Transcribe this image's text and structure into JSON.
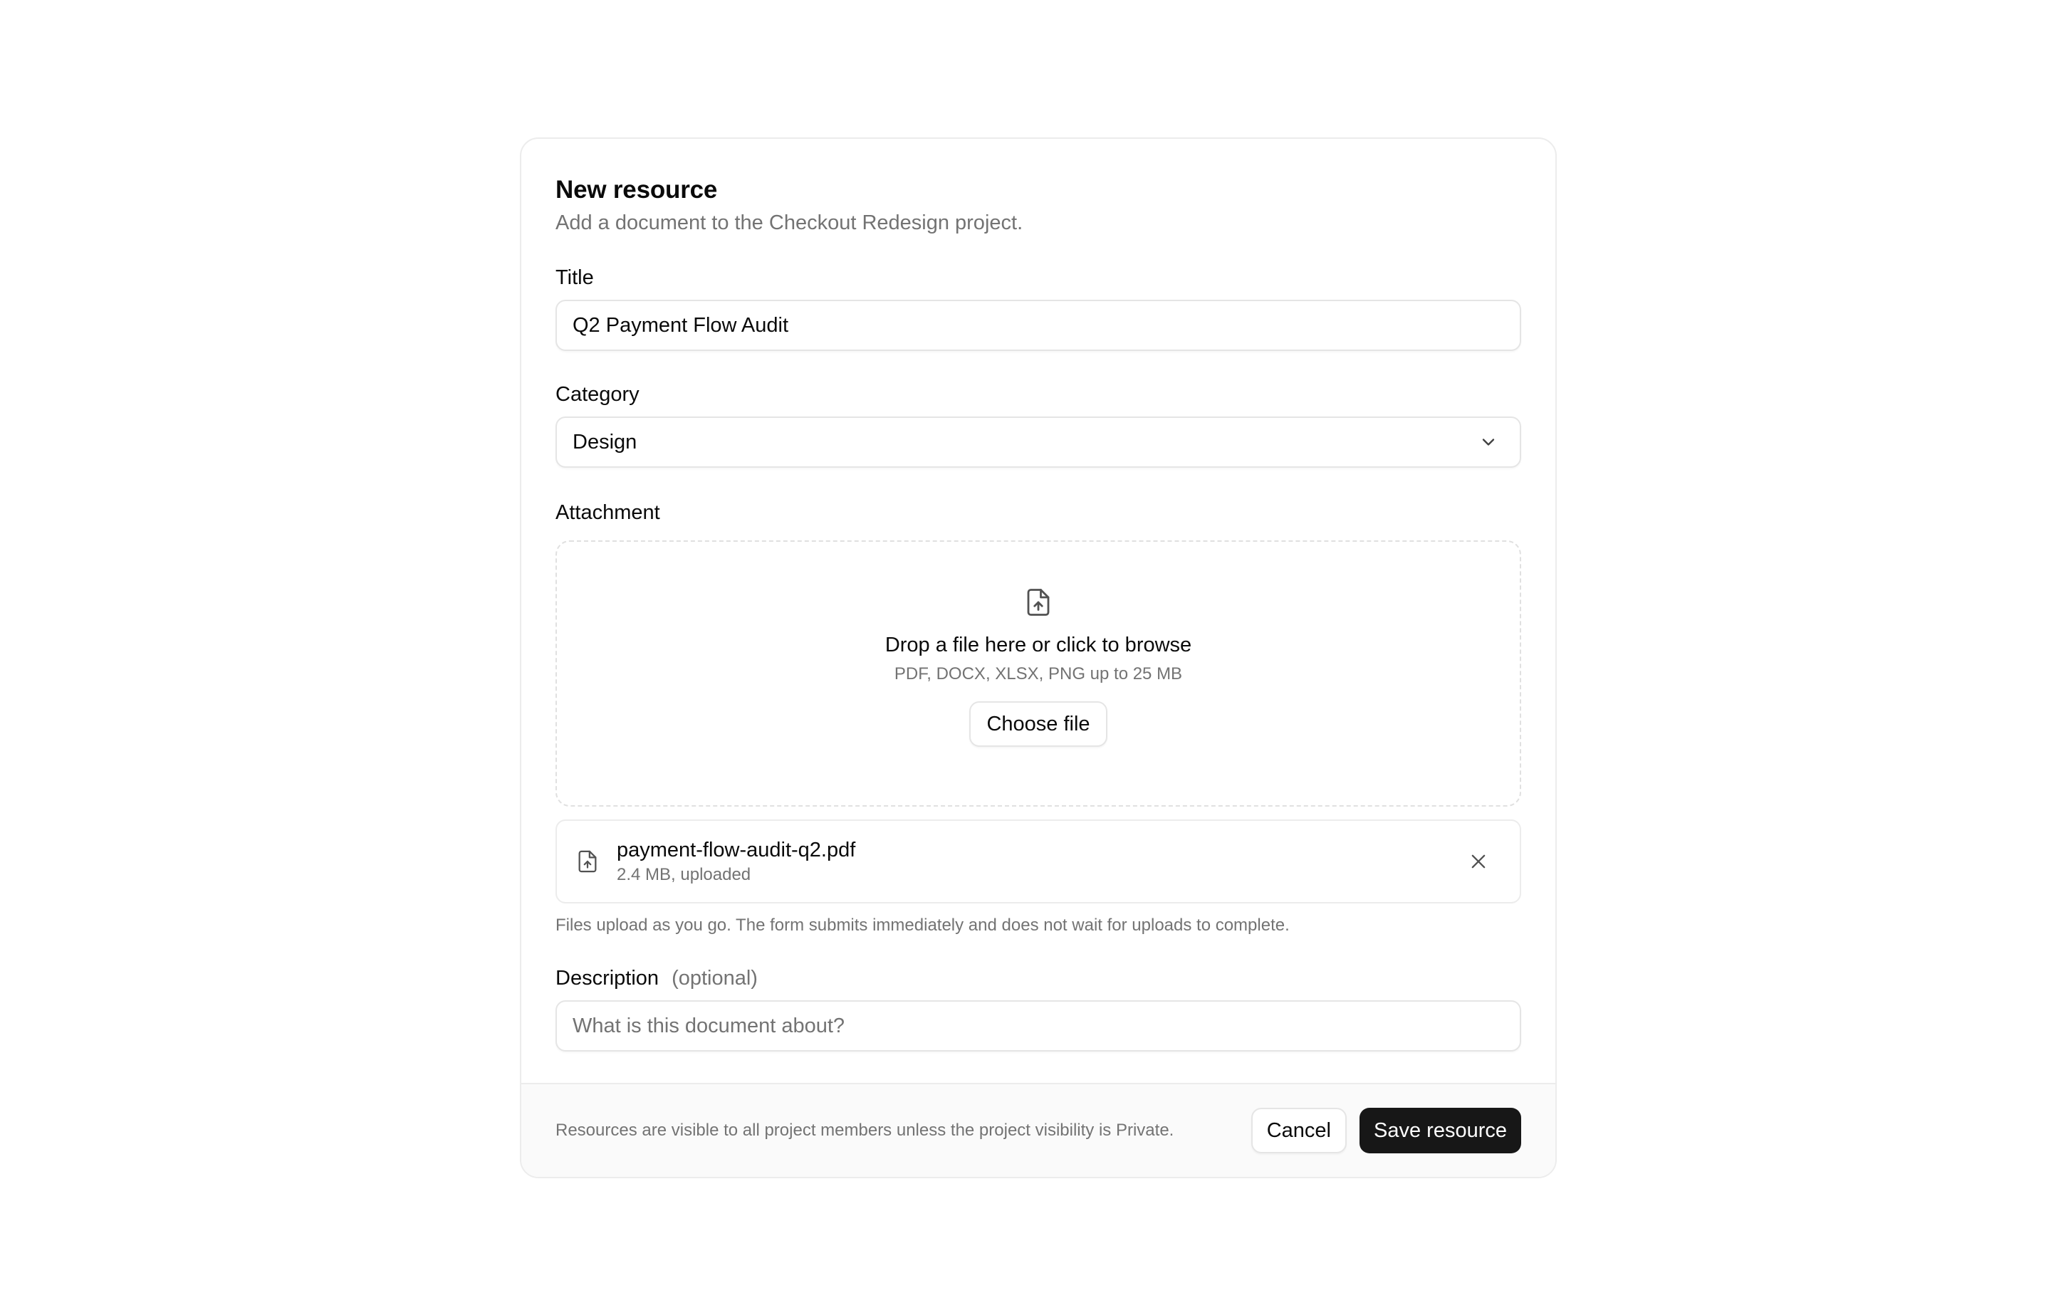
{
  "form": {
    "title": "New resource",
    "subtitle": "Add a document to the Checkout Redesign project."
  },
  "fields": {
    "title": {
      "label": "Title",
      "value": "Q2 Payment Flow Audit"
    },
    "category": {
      "label": "Category",
      "value": "Design",
      "icon": "chevron-down-icon"
    },
    "attachment": {
      "label": "Attachment",
      "dropzone": {
        "icon": "file-upload-icon",
        "title": "Drop a file here or click to browse",
        "hint": "PDF, DOCX, XLSX, PNG up to 25 MB",
        "button_label": "Choose file"
      },
      "file": {
        "icon": "file-upload-icon",
        "name": "payment-flow-audit-q2.pdf",
        "meta": "2.4 MB, uploaded",
        "remove_icon": "close-icon"
      },
      "helper": "Files upload as you go. The form submits immediately and does not wait for uploads to complete."
    },
    "description": {
      "label": "Description",
      "optional": "(optional)",
      "placeholder": "What is this document about?"
    }
  },
  "footer": {
    "note": "Resources are visible to all project members unless the project visibility is Private.",
    "cancel_label": "Cancel",
    "save_label": "Save resource"
  },
  "colors": {
    "primary_button": "#171717",
    "muted_text": "#737373",
    "border": "#e5e5e5",
    "footer_bg": "#fafafa"
  }
}
